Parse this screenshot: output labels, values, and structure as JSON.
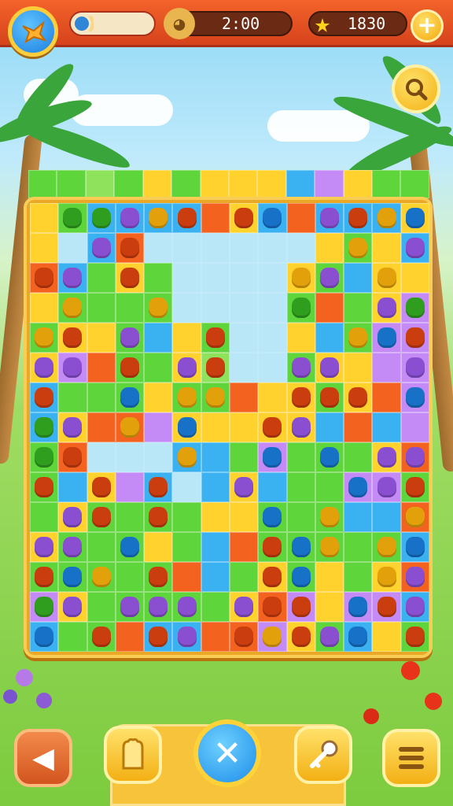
{
  "hud": {
    "timer": "2:00",
    "score": "1830",
    "level_progress": 0.1
  },
  "icons": {
    "menu": "bird-star-icon",
    "timer": "clock-character-icon",
    "score": "star-icon",
    "add": "plus-icon",
    "hint": "magnifier-icon",
    "back": "rewind-icon",
    "glove": "glove-icon",
    "close": "x-icon",
    "key": "key-icon",
    "list": "menu-lines-icon"
  },
  "colors": {
    "green": "#5ed53a",
    "yellow": "#ffd22e",
    "blue": "#3ab2f2",
    "orange": "#f3631f",
    "purple": "#c48af5",
    "empty": "#b9e7f8",
    "board_frame": "#e9a826",
    "top_bar": "#f3632a"
  },
  "board": {
    "top_row": [
      "g",
      "g",
      "l",
      "g",
      "y",
      "g",
      "y",
      "y",
      "y",
      "b",
      "p",
      "y",
      "g",
      "g"
    ],
    "rows": [
      [
        "y",
        "g",
        "b",
        "b",
        "b",
        "b",
        "o",
        "y",
        "b",
        "o",
        "b",
        "b",
        "b",
        "y"
      ],
      [
        "y",
        "e",
        "b",
        "o",
        "e",
        "e",
        "e",
        "e",
        "e",
        "e",
        "y",
        "g",
        "y",
        "b"
      ],
      [
        "o",
        "b",
        "g",
        "y",
        "g",
        "e",
        "e",
        "e",
        "e",
        "y",
        "g",
        "b",
        "y",
        "y"
      ],
      [
        "y",
        "g",
        "g",
        "g",
        "g",
        "e",
        "e",
        "e",
        "e",
        "g",
        "o",
        "g",
        "y",
        "p"
      ],
      [
        "g",
        "y",
        "y",
        "g",
        "b",
        "y",
        "g",
        "e",
        "e",
        "y",
        "b",
        "g",
        "p",
        "p"
      ],
      [
        "y",
        "p",
        "o",
        "g",
        "g",
        "y",
        "l",
        "e",
        "e",
        "g",
        "y",
        "y",
        "p",
        "p"
      ],
      [
        "b",
        "g",
        "g",
        "g",
        "y",
        "g",
        "g",
        "o",
        "y",
        "y",
        "g",
        "y",
        "o",
        "p"
      ],
      [
        "b",
        "y",
        "o",
        "o",
        "p",
        "y",
        "y",
        "y",
        "y",
        "y",
        "b",
        "o",
        "b",
        "p"
      ],
      [
        "g",
        "o",
        "e",
        "e",
        "e",
        "b",
        "b",
        "g",
        "p",
        "g",
        "g",
        "g",
        "y",
        "o"
      ],
      [
        "g",
        "b",
        "y",
        "p",
        "b",
        "e",
        "b",
        "y",
        "b",
        "g",
        "g",
        "p",
        "p",
        "g"
      ],
      [
        "g",
        "y",
        "g",
        "g",
        "g",
        "g",
        "y",
        "y",
        "g",
        "g",
        "g",
        "b",
        "b",
        "o"
      ],
      [
        "y",
        "g",
        "g",
        "g",
        "y",
        "g",
        "b",
        "o",
        "g",
        "g",
        "g",
        "g",
        "g",
        "b"
      ],
      [
        "g",
        "g",
        "g",
        "g",
        "g",
        "o",
        "b",
        "g",
        "y",
        "g",
        "y",
        "g",
        "y",
        "o"
      ],
      [
        "p",
        "y",
        "g",
        "g",
        "g",
        "g",
        "g",
        "y",
        "o",
        "p",
        "y",
        "p",
        "p",
        "b"
      ],
      [
        "b",
        "g",
        "g",
        "o",
        "b",
        "b",
        "o",
        "o",
        "p",
        "y",
        "g",
        "b",
        "y",
        "g"
      ]
    ],
    "pieces": [
      [
        1,
        "g",
        "●"
      ],
      [
        2,
        "g",
        "●"
      ],
      [
        3,
        "p",
        "●"
      ],
      [
        4,
        "y",
        "●"
      ],
      [
        5,
        "o",
        "●"
      ],
      [
        7,
        "o",
        "●"
      ],
      [
        8,
        "b",
        "●"
      ],
      [
        10,
        "p",
        "●"
      ],
      [
        11,
        "o",
        "●"
      ],
      [
        12,
        "y",
        "●"
      ],
      [
        13,
        "b",
        "●"
      ],
      [
        15,
        "y",
        "●"
      ],
      [
        16,
        "p",
        "●"
      ],
      [
        17,
        "o",
        "●"
      ],
      [
        23,
        "y",
        "●"
      ],
      [
        25,
        "y",
        "●"
      ],
      [
        27,
        "p",
        "●"
      ],
      [
        28,
        "o",
        "●"
      ],
      [
        29,
        "p",
        "●"
      ],
      [
        31,
        "o",
        "●"
      ],
      [
        37,
        "y",
        "●"
      ],
      [
        38,
        "p",
        "●"
      ],
      [
        40,
        "y",
        "●"
      ],
      [
        43,
        "y",
        "●"
      ],
      [
        46,
        "y",
        "●"
      ],
      [
        48,
        "o",
        "●"
      ],
      [
        51,
        "g",
        "●"
      ],
      [
        54,
        "p",
        "●"
      ],
      [
        55,
        "g",
        "●"
      ],
      [
        56,
        "y",
        "●"
      ],
      [
        57,
        "o",
        "●"
      ],
      [
        59,
        "p",
        "●"
      ],
      [
        62,
        "o",
        "●"
      ],
      [
        63,
        "b",
        "●"
      ],
      [
        67,
        "y",
        "●"
      ],
      [
        68,
        "b",
        "●"
      ],
      [
        69,
        "o",
        "●"
      ],
      [
        70,
        "p",
        "●"
      ],
      [
        71,
        "p",
        "●"
      ],
      [
        73,
        "o",
        "●"
      ],
      [
        75,
        "p",
        "●"
      ],
      [
        76,
        "o",
        "●"
      ],
      [
        77,
        "p",
        "●"
      ],
      [
        79,
        "p",
        "●"
      ],
      [
        80,
        "p",
        "●"
      ],
      [
        83,
        "p",
        "●"
      ],
      [
        84,
        "o",
        "●"
      ],
      [
        87,
        "b",
        "●"
      ],
      [
        89,
        "y",
        "●"
      ],
      [
        90,
        "y",
        "●"
      ],
      [
        93,
        "o",
        "●"
      ],
      [
        94,
        "o",
        "●"
      ],
      [
        95,
        "o",
        "●"
      ],
      [
        97,
        "b",
        "●"
      ],
      [
        98,
        "g",
        "●"
      ],
      [
        99,
        "p",
        "●"
      ],
      [
        101,
        "y",
        "●"
      ],
      [
        103,
        "b",
        "●"
      ],
      [
        106,
        "o",
        "●"
      ],
      [
        107,
        "p",
        "●"
      ],
      [
        112,
        "g",
        "●"
      ],
      [
        113,
        "o",
        "●"
      ],
      [
        114,
        "b",
        "●"
      ],
      [
        117,
        "y",
        "●"
      ],
      [
        120,
        "b",
        "●"
      ],
      [
        122,
        "b",
        "●"
      ],
      [
        124,
        "p",
        "●"
      ],
      [
        125,
        "p",
        "●"
      ],
      [
        126,
        "o",
        "●"
      ],
      [
        128,
        "o",
        "●"
      ],
      [
        130,
        "o",
        "●"
      ],
      [
        131,
        "o",
        "●"
      ],
      [
        133,
        "p",
        "●"
      ],
      [
        137,
        "b",
        "●"
      ],
      [
        138,
        "p",
        "●"
      ],
      [
        139,
        "o",
        "●"
      ],
      [
        141,
        "p",
        "●"
      ],
      [
        142,
        "o",
        "●"
      ],
      [
        144,
        "o",
        "●"
      ],
      [
        148,
        "b",
        "●"
      ],
      [
        150,
        "y",
        "●"
      ],
      [
        153,
        "y",
        "●"
      ],
      [
        154,
        "p",
        "●"
      ],
      [
        155,
        "p",
        "●"
      ],
      [
        157,
        "b",
        "●"
      ],
      [
        162,
        "o",
        "●"
      ],
      [
        163,
        "b",
        "●"
      ],
      [
        164,
        "y",
        "●"
      ],
      [
        166,
        "y",
        "●"
      ],
      [
        167,
        "b",
        "●"
      ],
      [
        168,
        "o",
        "●"
      ],
      [
        169,
        "b",
        "●"
      ],
      [
        170,
        "y",
        "●"
      ],
      [
        172,
        "o",
        "●"
      ],
      [
        176,
        "o",
        "●"
      ],
      [
        177,
        "b",
        "●"
      ],
      [
        180,
        "y",
        "●"
      ],
      [
        181,
        "p",
        "●"
      ],
      [
        182,
        "g",
        "●"
      ],
      [
        183,
        "p",
        "●"
      ],
      [
        185,
        "p",
        "●"
      ],
      [
        186,
        "p",
        "●"
      ],
      [
        187,
        "p",
        "●"
      ],
      [
        189,
        "p",
        "●"
      ],
      [
        190,
        "o",
        "●"
      ],
      [
        191,
        "o",
        "●"
      ],
      [
        193,
        "b",
        "●"
      ],
      [
        194,
        "o",
        "●"
      ],
      [
        195,
        "p",
        "●"
      ],
      [
        196,
        "b",
        "●"
      ],
      [
        198,
        "o",
        "●"
      ],
      [
        200,
        "o",
        "●"
      ],
      [
        201,
        "p",
        "●"
      ],
      [
        203,
        "o",
        "●"
      ],
      [
        204,
        "y",
        "●"
      ],
      [
        205,
        "o",
        "●"
      ],
      [
        206,
        "p",
        "●"
      ],
      [
        207,
        "b",
        "●"
      ],
      [
        209,
        "o",
        "●"
      ]
    ]
  }
}
